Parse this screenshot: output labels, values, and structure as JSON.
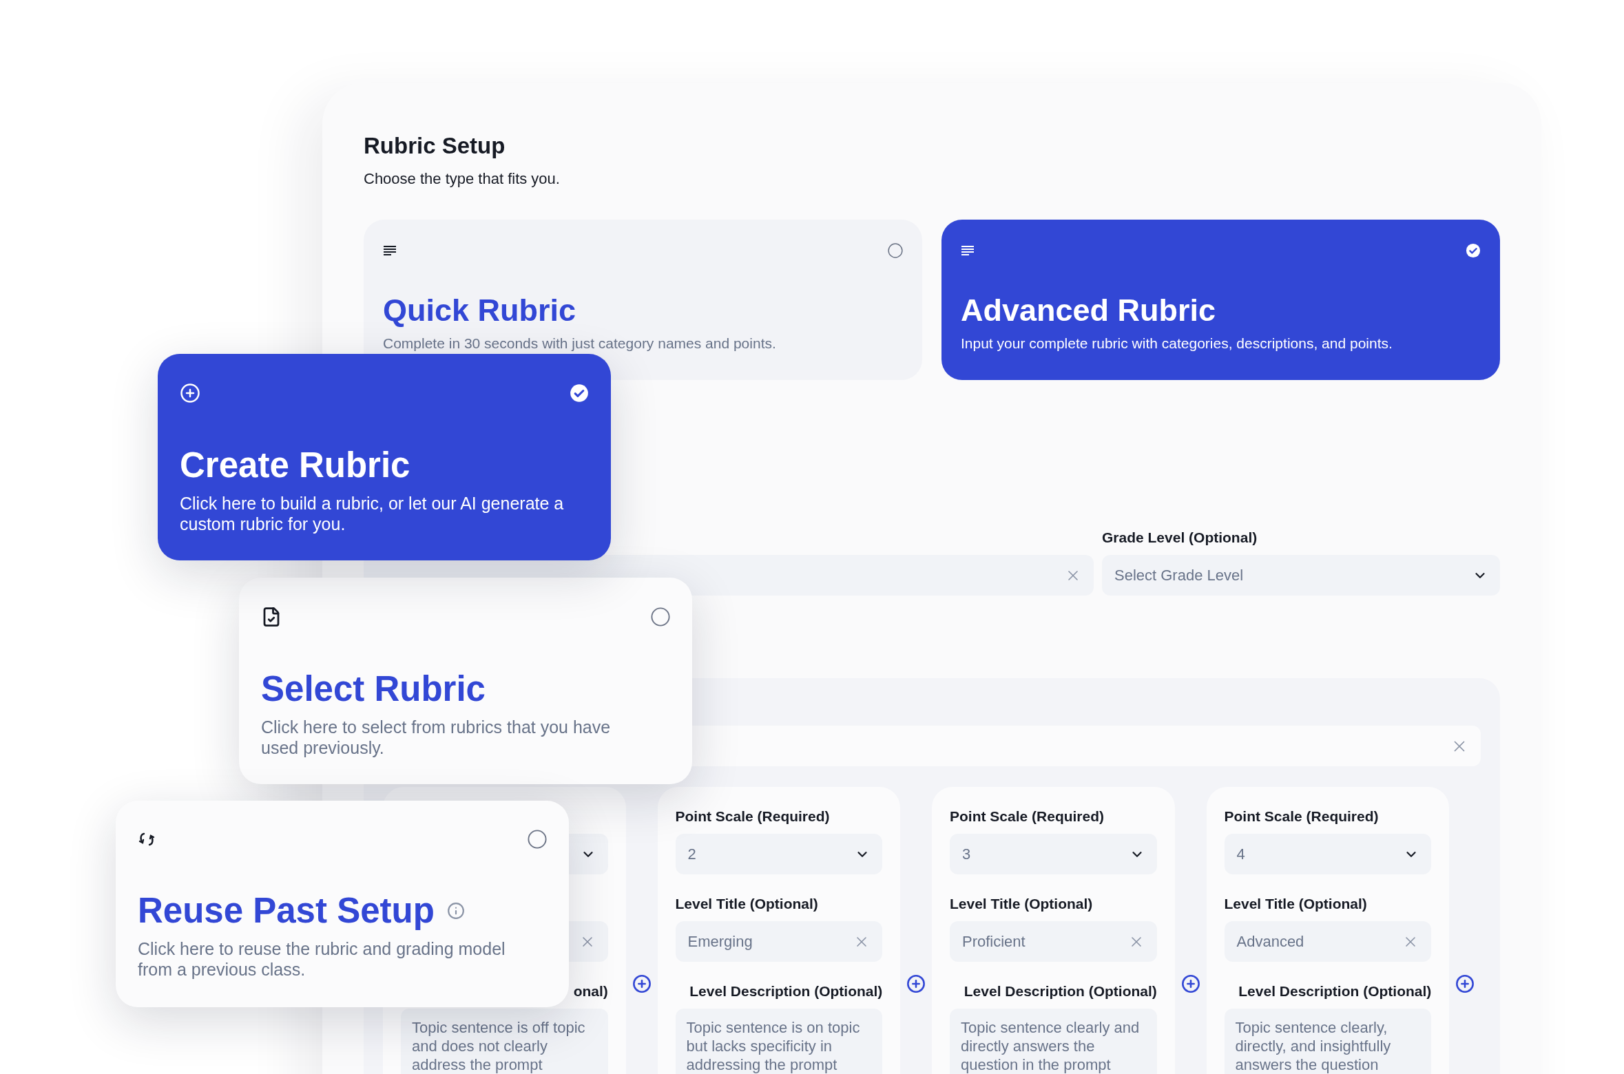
{
  "panel": {
    "title": "Rubric Setup",
    "subtitle": "Choose the type that fits you."
  },
  "rubric_types": [
    {
      "title": "Quick Rubric",
      "description": "Complete in 30 seconds with just category names and points.",
      "selected": false
    },
    {
      "title": "Advanced Rubric",
      "description": "Input your complete rubric with categories, descriptions, and points.",
      "selected": true
    }
  ],
  "grade_level": {
    "label": "Grade Level (Optional)",
    "placeholder": "Select Grade Level"
  },
  "levels": [
    {
      "description_label": "onal)",
      "description": "Topic sentence is off topic and does not clearly address the prompt"
    },
    {
      "point_scale_label": "Point Scale (Required)",
      "point_scale": "2",
      "title_label": "Level Title (Optional)",
      "title": "Emerging",
      "description_label": "Level Description (Optional)",
      "description": "Topic sentence is on topic but lacks specificity in addressing the prompt"
    },
    {
      "point_scale_label": "Point Scale (Required)",
      "point_scale": "3",
      "title_label": "Level Title (Optional)",
      "title": "Proficient",
      "description_label": "Level Description (Optional)",
      "description": "Topic sentence clearly and directly answers the question in the prompt"
    },
    {
      "point_scale_label": "Point Scale (Required)",
      "point_scale": "4",
      "title_label": "Level Title (Optional)",
      "title": "Advanced",
      "description_label": "Level Description (Optional)",
      "description": "Topic sentence clearly, directly, and insightfully answers the question"
    }
  ],
  "setup_options": [
    {
      "kind": "create",
      "title": "Create Rubric",
      "description": "Click here to build a rubric, or let our AI generate a custom rubric for you.",
      "selected": true,
      "info": false
    },
    {
      "kind": "select",
      "title": "Select Rubric",
      "description": "Click here to select from rubrics that you have used previously.",
      "selected": false,
      "info": false
    },
    {
      "kind": "reuse",
      "title": "Reuse Past Setup",
      "description": "Click here to reuse the rubric and grading model from a previous class.",
      "selected": false,
      "info": true
    }
  ]
}
